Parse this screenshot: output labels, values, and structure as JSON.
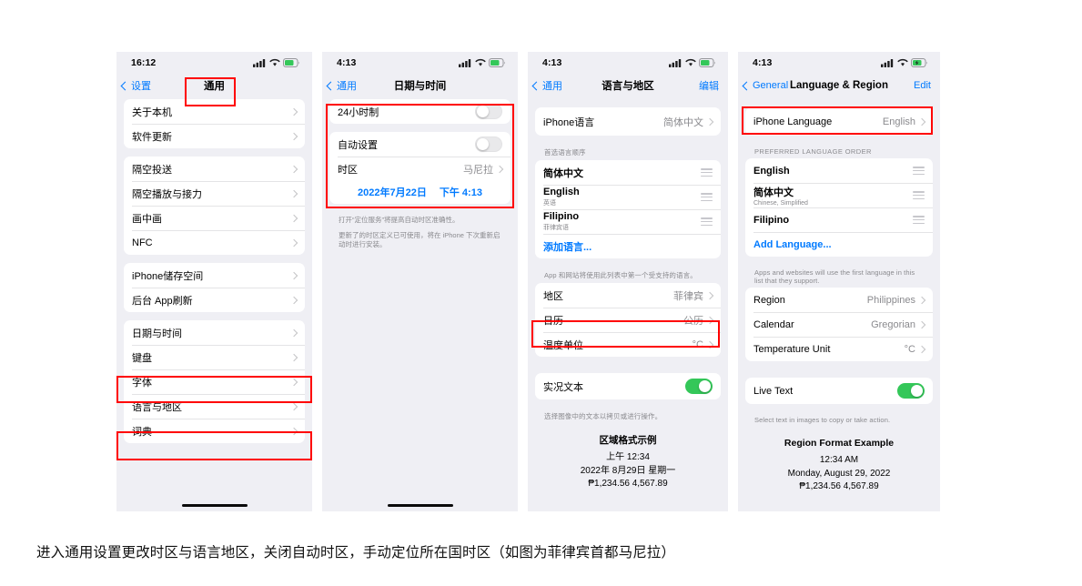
{
  "caption": "进入通用设置更改时区与语言地区，关闭自动时区，手动定位所在国时区（如图为菲律宾首都马尼拉）",
  "colors": {
    "highlight": "#ff0000",
    "accent_blue": "#007aff",
    "toggle_on": "#34c759",
    "screen_bg": "#efeff4"
  },
  "panels": [
    {
      "id": "general",
      "status": {
        "time": "16:12",
        "signal": "cellular-signal-icon",
        "wifi": "wifi-icon",
        "battery": "battery-icon",
        "charging": false
      },
      "nav": {
        "back": "设置",
        "title": "通用",
        "right": ""
      },
      "groups": [
        {
          "rows": [
            {
              "label": "关于本机",
              "value": "",
              "accessory": "disclosure"
            },
            {
              "label": "软件更新",
              "value": "",
              "accessory": "disclosure"
            }
          ]
        },
        {
          "rows": [
            {
              "label": "隔空投送",
              "value": "",
              "accessory": "disclosure"
            },
            {
              "label": "隔空播放与接力",
              "value": "",
              "accessory": "disclosure"
            },
            {
              "label": "画中画",
              "value": "",
              "accessory": "disclosure"
            },
            {
              "label": "NFC",
              "value": "",
              "accessory": "disclosure"
            }
          ]
        },
        {
          "rows": [
            {
              "label": "iPhone储存空间",
              "value": "",
              "accessory": "disclosure"
            },
            {
              "label": "后台 App刷新",
              "value": "",
              "accessory": "disclosure"
            }
          ]
        },
        {
          "rows": [
            {
              "label": "日期与时间",
              "value": "",
              "accessory": "disclosure"
            },
            {
              "label": "键盘",
              "value": "",
              "accessory": "disclosure"
            },
            {
              "label": "字体",
              "value": "",
              "accessory": "disclosure"
            },
            {
              "label": "语言与地区",
              "value": "",
              "accessory": "disclosure"
            },
            {
              "label": "词典",
              "value": "",
              "accessory": "disclosure"
            }
          ]
        }
      ]
    },
    {
      "id": "date-time",
      "status": {
        "time": "4:13",
        "signal": "cellular-signal-icon",
        "wifi": "wifi-icon",
        "battery": "battery-icon",
        "charging": false
      },
      "nav": {
        "back": "通用",
        "title": "日期与时间",
        "right": ""
      },
      "rows": {
        "hour24_label": "24小时制",
        "hour24_on": false,
        "auto_label": "自动设置",
        "auto_on": false,
        "timezone_label": "时区",
        "timezone_value": "马尼拉",
        "date_display": "2022年7月22日",
        "time_display": "下午 4:13"
      },
      "footnotes": [
        "打开“定位服务”将提高自动时区准确性。",
        "更新了的时区定义已可使用，将在 iPhone 下次重新启动时进行安装。"
      ]
    },
    {
      "id": "language-region-zh",
      "status": {
        "time": "4:13",
        "signal": "cellular-signal-icon",
        "wifi": "wifi-icon",
        "battery": "battery-icon",
        "charging": false
      },
      "nav": {
        "back": "通用",
        "title": "语言与地区",
        "right": "编辑"
      },
      "iphone_language": {
        "label": "iPhone语言",
        "value": "简体中文"
      },
      "pref_header": "首选语言顺序",
      "languages": [
        {
          "name": "简体中文",
          "sub": ""
        },
        {
          "name": "English",
          "sub": "英语"
        },
        {
          "name": "Filipino",
          "sub": "菲律宾语"
        }
      ],
      "add_language": "添加语言...",
      "languages_footnote": "App 和网站将使用此列表中第一个受支持的语言。",
      "settings": [
        {
          "label": "地区",
          "value": "菲律宾"
        },
        {
          "label": "日历",
          "value": "公历"
        },
        {
          "label": "温度单位",
          "value": "°C"
        }
      ],
      "live_text": {
        "label": "实况文本",
        "on": true,
        "footnote": "选择图像中的文本以拷贝或进行操作。"
      },
      "example": {
        "title": "区域格式示例",
        "lines": [
          "上午 12:34",
          "2022年 8月29日 星期一",
          "₱1,234.56   4,567.89"
        ]
      }
    },
    {
      "id": "language-region-en",
      "status": {
        "time": "4:13",
        "signal": "cellular-signal-icon",
        "wifi": "wifi-icon",
        "battery": "battery-icon",
        "charging": true
      },
      "nav": {
        "back": "General",
        "title": "Language & Region",
        "right": "Edit"
      },
      "iphone_language": {
        "label": "iPhone Language",
        "value": "English"
      },
      "pref_header": "PREFERRED LANGUAGE ORDER",
      "languages": [
        {
          "name": "English",
          "sub": ""
        },
        {
          "name": "简体中文",
          "sub": "Chinese, Simplified"
        },
        {
          "name": "Filipino",
          "sub": ""
        }
      ],
      "add_language": "Add Language...",
      "languages_footnote": "Apps and websites will use the first language in this list that they support.",
      "settings": [
        {
          "label": "Region",
          "value": "Philippines"
        },
        {
          "label": "Calendar",
          "value": "Gregorian"
        },
        {
          "label": "Temperature Unit",
          "value": "°C"
        }
      ],
      "live_text": {
        "label": "Live Text",
        "on": true,
        "footnote": "Select text in images to copy or take action."
      },
      "example": {
        "title": "Region Format Example",
        "lines": [
          "12:34 AM",
          "Monday, August 29, 2022",
          "₱1,234.56   4,567.89"
        ]
      }
    }
  ]
}
